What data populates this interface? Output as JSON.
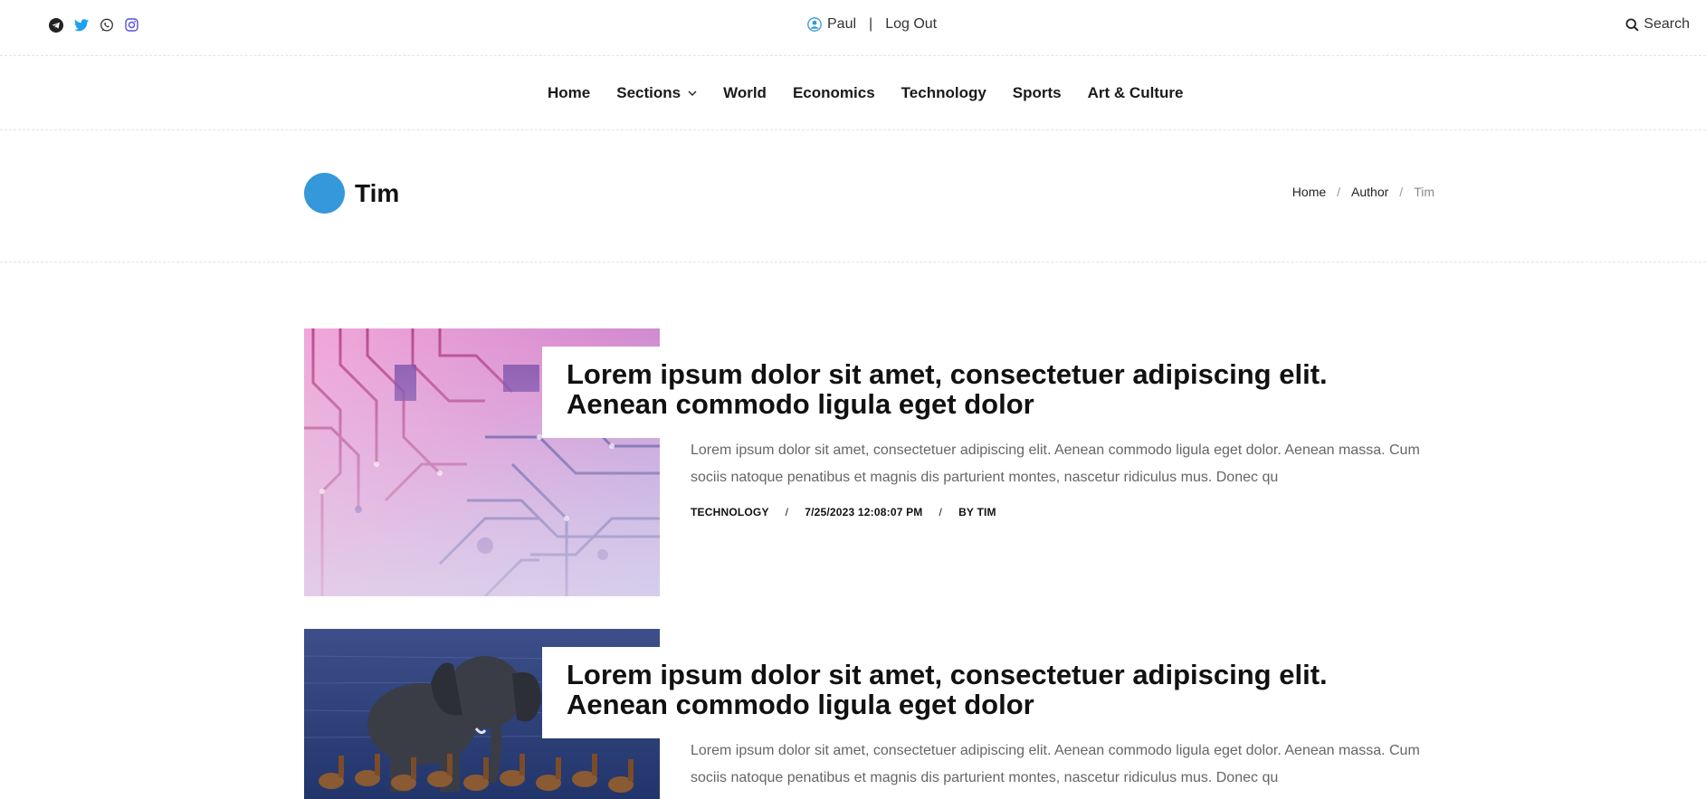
{
  "topbar": {
    "user_name": "Paul",
    "separator": "|",
    "logout_label": "Log Out",
    "search_label": "Search",
    "social_icons": [
      "telegram-icon",
      "twitter-icon",
      "whatsapp-icon",
      "instagram-icon"
    ]
  },
  "nav": {
    "items": [
      {
        "label": "Home"
      },
      {
        "label": "Sections"
      },
      {
        "label": "World"
      },
      {
        "label": "Economics"
      },
      {
        "label": "Technology"
      },
      {
        "label": "Sports"
      },
      {
        "label": "Art & Culture"
      }
    ]
  },
  "author": {
    "name": "Tim",
    "avatar_color": "#3498db"
  },
  "breadcrumb": {
    "items": [
      "Home",
      "Author",
      "Tim"
    ],
    "separator": "/"
  },
  "posts": [
    {
      "title": "Lorem ipsum dolor sit amet, consectetuer adipiscing elit. Aenean commodo ligula eget dolor",
      "excerpt": "Lorem ipsum dolor sit amet, consectetuer adipiscing elit. Aenean commodo ligula eget dolor. Aenean massa. Cum sociis natoque penatibus et magnis dis parturient montes, nascetur ridiculus mus. Donec qu",
      "category": "TECHNOLOGY",
      "date": "7/25/2023 12:08:07 PM",
      "byline": "BY TIM",
      "meta_separator": "/",
      "image": "circuit-board-image"
    },
    {
      "title": "Lorem ipsum dolor sit amet, consectetuer adipiscing elit. Aenean commodo ligula eget dolor",
      "excerpt": "Lorem ipsum dolor sit amet, consectetuer adipiscing elit. Aenean commodo ligula eget dolor. Aenean massa. Cum sociis natoque penatibus et magnis dis parturient montes, nascetur ridiculus mus. Donec qu",
      "image": "elephant-antelope-image"
    }
  ],
  "colors": {
    "accent": "#3498db",
    "text": "#111111",
    "muted": "#666666",
    "twitter": "#1da1f2",
    "instagram": "#5851db"
  }
}
